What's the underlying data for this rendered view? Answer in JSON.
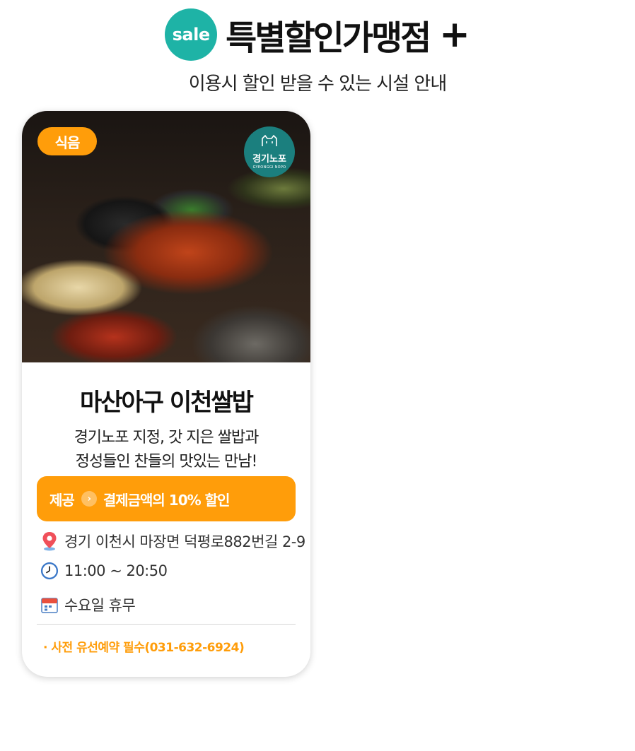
{
  "header": {
    "badge": "sale",
    "title": "특별할인가맹점",
    "plus": "+",
    "subtitle": "이용시 할인 받을 수 있는 시설 안내"
  },
  "card": {
    "category": "식음",
    "logo": {
      "name": "경기노포",
      "sub": "GYEONGGI NOPO",
      "icon": "cat-face-icon"
    },
    "name": "마산아구 이천쌀밥",
    "description": [
      "경기노포 지정, 갓 지은 쌀밥과",
      "정성들인 찬들의 맛있는 만남!"
    ],
    "offer": {
      "label": "제공",
      "arrow": "›",
      "text": "결제금액의 10% 할인"
    },
    "address": "경기 이천시 마장면 덕평로882번길 2-9",
    "hours": "11:00 ~ 20:50",
    "closed": "수요일 휴무",
    "notice": "· 사전 유선예약 필수(031-632-6924)"
  },
  "colors": {
    "accent": "#ff9d0a",
    "sale_badge": "#1eb3a6",
    "logo_bg": "#1b7f7e"
  }
}
